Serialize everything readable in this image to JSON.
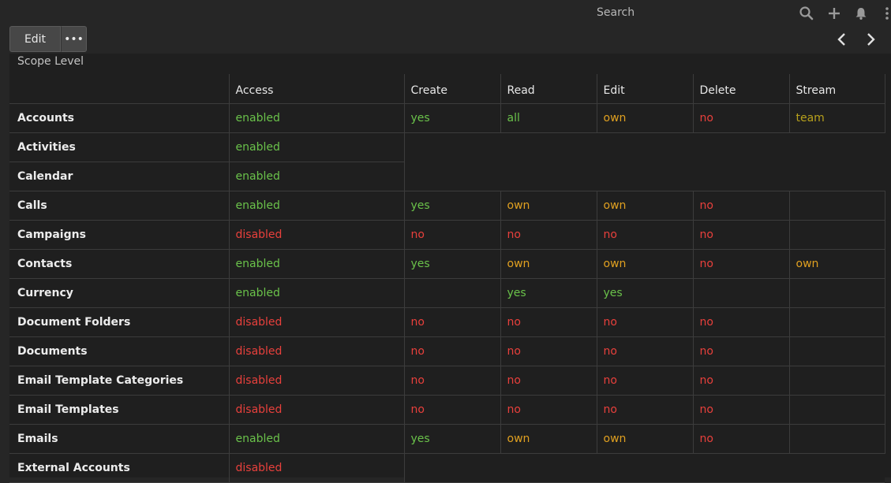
{
  "topbar": {
    "search_placeholder": "Search",
    "icons": [
      "search-icon",
      "plus-icon",
      "bell-icon",
      "kebab-icon"
    ]
  },
  "toolbar": {
    "edit_label": "Edit",
    "more_label": "•••"
  },
  "panel": {
    "title": "Scope Level"
  },
  "table": {
    "headers": [
      "",
      "Access",
      "Create",
      "Read",
      "Edit",
      "Delete",
      "Stream"
    ],
    "rows": [
      {
        "scope": "Accounts",
        "access": "enabled",
        "create": "yes",
        "read": "all",
        "edit": "own",
        "delete": "no",
        "stream": "team"
      },
      {
        "scope": "Activities",
        "access": "enabled",
        "create": "",
        "read": "",
        "edit": "",
        "delete": "",
        "stream": ""
      },
      {
        "scope": "Calendar",
        "access": "enabled",
        "create": "",
        "read": "",
        "edit": "",
        "delete": "",
        "stream": ""
      },
      {
        "scope": "Calls",
        "access": "enabled",
        "create": "yes",
        "read": "own",
        "edit": "own",
        "delete": "no",
        "stream": ""
      },
      {
        "scope": "Campaigns",
        "access": "disabled",
        "create": "no",
        "read": "no",
        "edit": "no",
        "delete": "no",
        "stream": ""
      },
      {
        "scope": "Contacts",
        "access": "enabled",
        "create": "yes",
        "read": "own",
        "edit": "own",
        "delete": "no",
        "stream": "own"
      },
      {
        "scope": "Currency",
        "access": "enabled",
        "create": "",
        "read": "yes",
        "edit": "yes",
        "delete": "",
        "stream": ""
      },
      {
        "scope": "Document Folders",
        "access": "disabled",
        "create": "no",
        "read": "no",
        "edit": "no",
        "delete": "no",
        "stream": ""
      },
      {
        "scope": "Documents",
        "access": "disabled",
        "create": "no",
        "read": "no",
        "edit": "no",
        "delete": "no",
        "stream": ""
      },
      {
        "scope": "Email Template Categories",
        "access": "disabled",
        "create": "no",
        "read": "no",
        "edit": "no",
        "delete": "no",
        "stream": ""
      },
      {
        "scope": "Email Templates",
        "access": "disabled",
        "create": "no",
        "read": "no",
        "edit": "no",
        "delete": "no",
        "stream": ""
      },
      {
        "scope": "Emails",
        "access": "enabled",
        "create": "yes",
        "read": "own",
        "edit": "own",
        "delete": "no",
        "stream": ""
      },
      {
        "scope": "External Accounts",
        "access": "disabled",
        "create": "",
        "read": "",
        "edit": "",
        "delete": "",
        "stream": ""
      }
    ]
  },
  "colors": {
    "enabled": "#6ac24a",
    "disabled": "#e8403c",
    "own": "#e0a020",
    "team": "#b8a11c"
  }
}
